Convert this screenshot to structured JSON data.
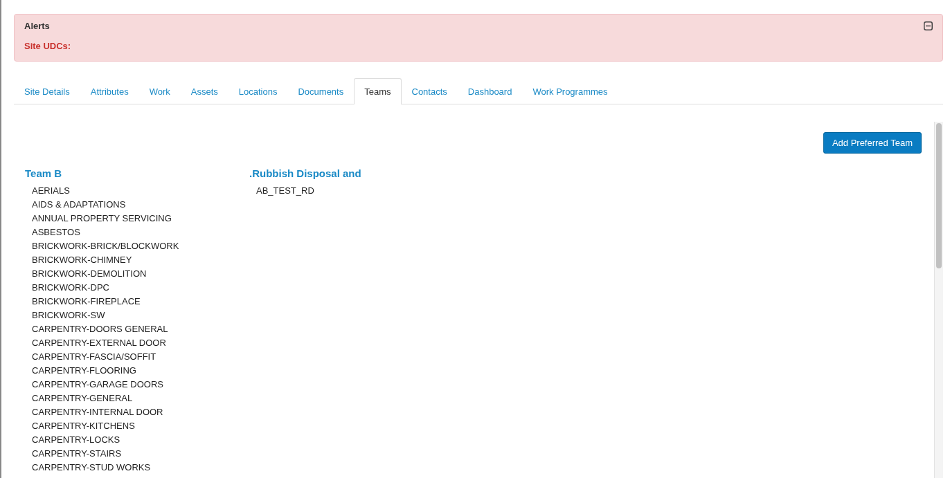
{
  "alerts": {
    "title": "Alerts",
    "message": "Site UDCs:"
  },
  "tabs": [
    {
      "label": "Site Details",
      "selected": false
    },
    {
      "label": "Attributes",
      "selected": false
    },
    {
      "label": "Work",
      "selected": false
    },
    {
      "label": "Assets",
      "selected": false
    },
    {
      "label": "Locations",
      "selected": false
    },
    {
      "label": "Documents",
      "selected": false
    },
    {
      "label": "Teams",
      "selected": true
    },
    {
      "label": "Contacts",
      "selected": false
    },
    {
      "label": "Dashboard",
      "selected": false
    },
    {
      "label": "Work Programmes",
      "selected": false
    }
  ],
  "add_button": "Add Preferred Team",
  "teams": [
    {
      "name": "Team B",
      "trades": [
        "AERIALS",
        "AIDS & ADAPTATIONS",
        "ANNUAL PROPERTY SERVICING",
        "ASBESTOS",
        "BRICKWORK-BRICK/BLOCKWORK",
        "BRICKWORK-CHIMNEY",
        "BRICKWORK-DEMOLITION",
        "BRICKWORK-DPC",
        "BRICKWORK-FIREPLACE",
        "BRICKWORK-SW",
        "CARPENTRY-DOORS GENERAL",
        "CARPENTRY-EXTERNAL DOOR",
        "CARPENTRY-FASCIA/SOFFIT",
        "CARPENTRY-FLOORING",
        "CARPENTRY-GARAGE DOORS",
        "CARPENTRY-GENERAL",
        "CARPENTRY-INTERNAL DOOR",
        "CARPENTRY-KITCHENS",
        "CARPENTRY-LOCKS",
        "CARPENTRY-STAIRS",
        "CARPENTRY-STUD WORKS"
      ]
    },
    {
      "name": ".Rubbish Disposal and",
      "trades": [
        "AB_TEST_RD"
      ]
    }
  ]
}
